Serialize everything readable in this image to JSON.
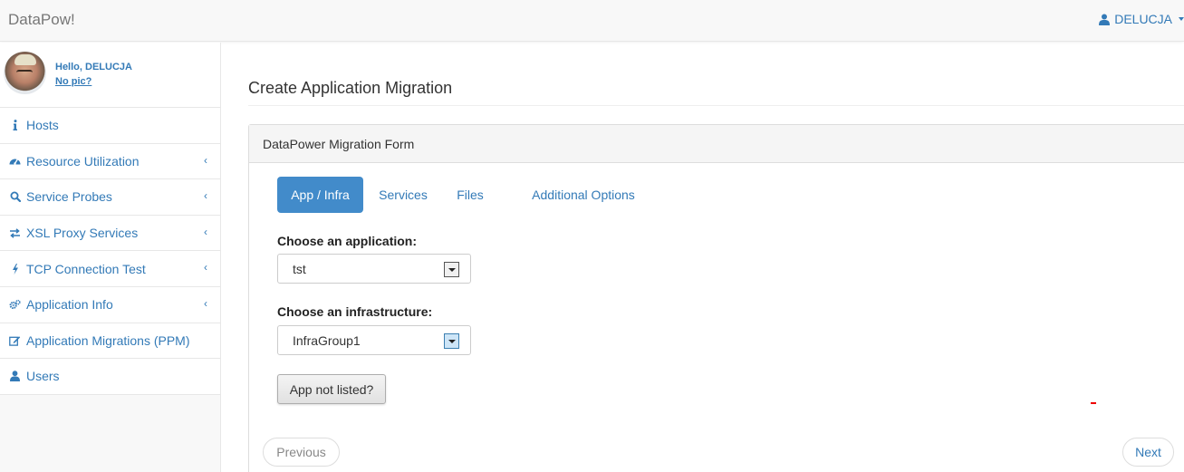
{
  "navbar": {
    "brand": "DataPow!",
    "user_name": "DELUCJA"
  },
  "profile": {
    "greeting": "Hello, DELUCJA",
    "no_pic_link": "No pic?"
  },
  "sidebar": {
    "items": [
      {
        "label": "Hosts",
        "icon": "info-icon",
        "has_submenu": false
      },
      {
        "label": "Resource Utilization",
        "icon": "dashboard-icon",
        "has_submenu": true
      },
      {
        "label": "Service Probes",
        "icon": "search-icon",
        "has_submenu": true
      },
      {
        "label": "XSL Proxy Services",
        "icon": "exchange-icon",
        "has_submenu": true
      },
      {
        "label": "TCP Connection Test",
        "icon": "bolt-icon",
        "has_submenu": true
      },
      {
        "label": "Application Info",
        "icon": "cogs-icon",
        "has_submenu": true
      },
      {
        "label": "Application Migrations (PPM)",
        "icon": "edit-icon",
        "has_submenu": false
      },
      {
        "label": "Users",
        "icon": "user-icon",
        "has_submenu": false
      }
    ]
  },
  "main": {
    "page_title": "Create Application Migration",
    "panel_heading": "DataPower Migration Form",
    "tabs": [
      {
        "label": "App / Infra",
        "active": true
      },
      {
        "label": "Services",
        "active": false
      },
      {
        "label": "Files",
        "active": false
      },
      {
        "label": "Additional Options",
        "active": false
      }
    ],
    "application": {
      "label": "Choose an application:",
      "value": "tst"
    },
    "infrastructure": {
      "label": "Choose an infrastructure:",
      "value": "InfraGroup1"
    },
    "app_not_listed_label": "App not listed?",
    "previous_label": "Previous",
    "next_label": "Next"
  },
  "colors": {
    "link": "#337ab7",
    "active_tab": "#428bca",
    "navbar_bg": "#f8f8f8"
  }
}
